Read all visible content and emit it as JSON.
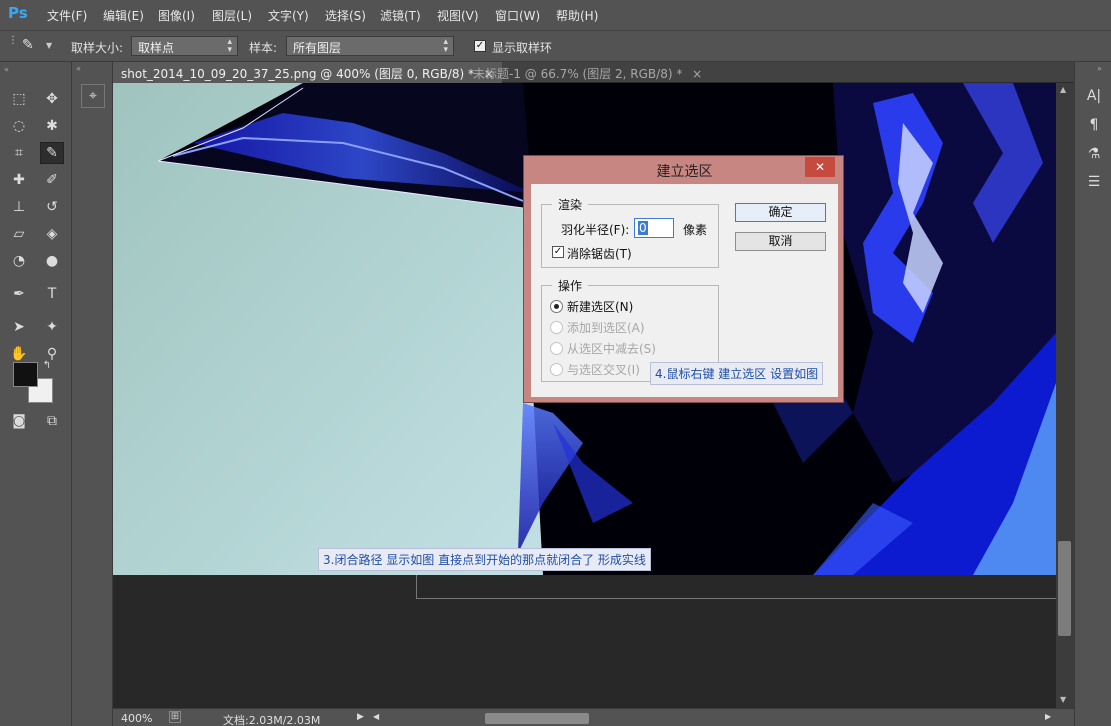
{
  "app": {
    "logo": "Ps"
  },
  "menu": [
    "文件(F)",
    "编辑(E)",
    "图像(I)",
    "图层(L)",
    "文字(Y)",
    "选择(S)",
    "滤镜(T)",
    "视图(V)",
    "窗口(W)",
    "帮助(H)"
  ],
  "options": {
    "sample_size_label": "取样大小:",
    "sample_size_value": "取样点",
    "sample_label": "样本:",
    "sample_value": "所有图层",
    "show_ring_label": "显示取样环",
    "show_ring_checked": true
  },
  "tabs": [
    {
      "label": "shot_2014_10_09_20_37_25.png @ 400% (图层 0, RGB/8) *",
      "active": true
    },
    {
      "label": "未标题-1 @ 66.7% (图层 2, RGB/8) *",
      "active": false
    }
  ],
  "tab_close": "×",
  "tools": [
    {
      "name": "marquee-icon",
      "glyph": "⬚"
    },
    {
      "name": "move-icon",
      "glyph": "✥"
    },
    {
      "name": "lasso-icon",
      "glyph": "◌"
    },
    {
      "name": "magic-wand-icon",
      "glyph": "✱"
    },
    {
      "name": "crop-icon",
      "glyph": "⌗"
    },
    {
      "name": "eyedropper-icon",
      "glyph": "✎"
    },
    {
      "name": "healing-brush-icon",
      "glyph": "✚"
    },
    {
      "name": "brush-icon",
      "glyph": "✐"
    },
    {
      "name": "clone-stamp-icon",
      "glyph": "⊥"
    },
    {
      "name": "history-brush-icon",
      "glyph": "↺"
    },
    {
      "name": "eraser-icon",
      "glyph": "▱"
    },
    {
      "name": "paint-bucket-icon",
      "glyph": "◈"
    },
    {
      "name": "blur-icon",
      "glyph": "◔"
    },
    {
      "name": "dodge-icon",
      "glyph": "●"
    },
    {
      "name": "pen-icon",
      "glyph": "✒"
    },
    {
      "name": "type-icon",
      "glyph": "T"
    },
    {
      "name": "path-selection-icon",
      "glyph": "➤"
    },
    {
      "name": "shape-icon",
      "glyph": "✦"
    },
    {
      "name": "hand-icon",
      "glyph": "✋"
    },
    {
      "name": "zoom-icon",
      "glyph": "⚲"
    }
  ],
  "colors": {
    "foreground": "#111111",
    "background": "#f0f0f0",
    "accent": "#3d7bd8",
    "dialog_frame": "#c88683"
  },
  "dialog": {
    "title": "建立选区",
    "close": "✕",
    "render_group": "渲染",
    "feather_label": "羽化半径(F):",
    "feather_value": "0",
    "feather_unit": "像素",
    "antialias_label": "消除锯齿(T)",
    "antialias_checked": true,
    "op_group": "操作",
    "ops": [
      {
        "label": "新建选区(N)",
        "selected": true,
        "enabled": true
      },
      {
        "label": "添加到选区(A)",
        "selected": false,
        "enabled": false
      },
      {
        "label": "从选区中减去(S)",
        "selected": false,
        "enabled": false
      },
      {
        "label": "与选区交叉(I)",
        "selected": false,
        "enabled": false
      }
    ],
    "ok": "确定",
    "cancel": "取消"
  },
  "annotations": {
    "note4": "4.鼠标右键  建立选区  设置如图",
    "note3": "3.闭合路径  显示如图  直接点到开始的那点就闭合了  形成实线"
  },
  "status": {
    "zoom": "400%",
    "doc": "文档:2.03M/2.03M"
  }
}
